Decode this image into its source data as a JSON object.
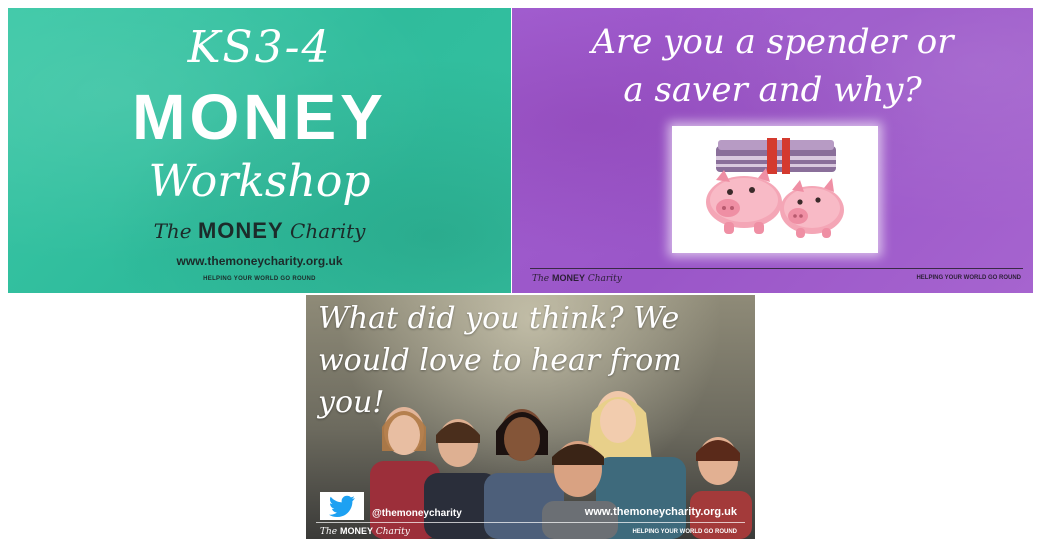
{
  "panel_teal": {
    "line1": "KS3-4",
    "line2": "MONEY",
    "line3": "Workshop",
    "brand_the": "The ",
    "brand_money": "MONEY",
    "brand_charity": " Charity",
    "url": "www.themoneycharity.org.uk",
    "tagline": "HELPING YOUR WORLD GO ROUND"
  },
  "panel_purple": {
    "question_line1": "Are you a spender or",
    "question_line2": "a saver and why?",
    "brand_the": "The ",
    "brand_money": "MONEY",
    "brand_charity": " Charity",
    "tagline": "HELPING YOUR WORLD GO ROUND"
  },
  "panel_photo": {
    "text_line1": "What did you think? We",
    "text_line2": "would love to hear from",
    "text_line3": "you!",
    "twitter_handle": "@themoneycharity",
    "url": "www.themoneycharity.org.uk",
    "brand_the": "The ",
    "brand_money": "MONEY",
    "brand_charity": " Charity",
    "tagline": "HELPING YOUR WORLD GO ROUND"
  },
  "colors": {
    "teal": "#35c3a2",
    "purple": "#a05dcf",
    "twitter_blue": "#1da1f2"
  }
}
